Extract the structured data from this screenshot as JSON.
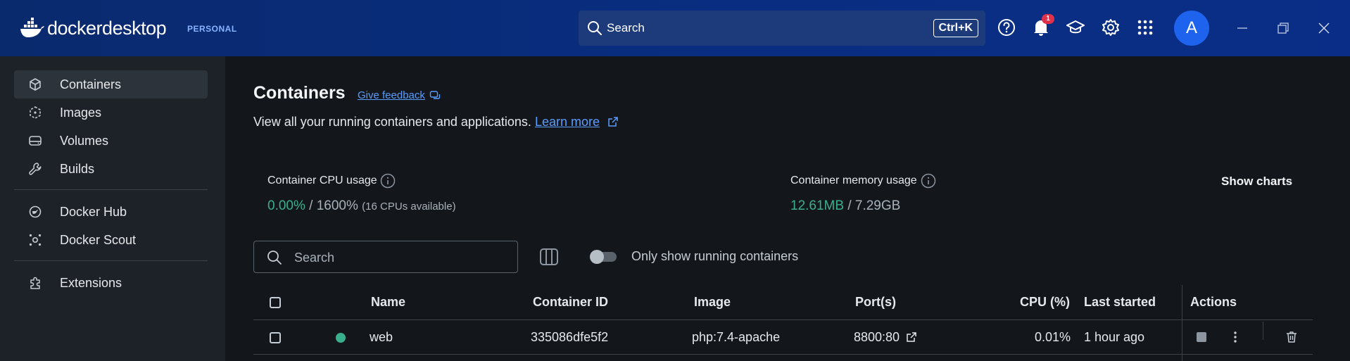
{
  "app": {
    "name_bold": "docker",
    "name_light": "desktop",
    "plan": "PERSONAL"
  },
  "topbar": {
    "search_placeholder": "Search",
    "shortcut": "Ctrl+K",
    "notifications_count": "1",
    "avatar_initial": "A",
    "icons": [
      "help-icon",
      "bell-icon",
      "learning-center-icon",
      "gear-icon",
      "apps-grid-icon",
      "minimize-icon",
      "restore-icon",
      "close-icon"
    ]
  },
  "sidebar": {
    "items": [
      {
        "label": "Containers",
        "icon": "containers-icon",
        "active": true
      },
      {
        "label": "Images",
        "icon": "images-icon"
      },
      {
        "label": "Volumes",
        "icon": "volumes-icon"
      },
      {
        "label": "Builds",
        "icon": "wrench-icon"
      },
      {
        "label": "Docker Hub",
        "icon": "docker-hub-icon"
      },
      {
        "label": "Docker Scout",
        "icon": "docker-scout-icon"
      },
      {
        "label": "Extensions",
        "icon": "extensions-icon"
      }
    ]
  },
  "main": {
    "title": "Containers",
    "feedback_label": "Give feedback",
    "subtitle": "View all your running containers and applications.",
    "learn_more": "Learn more",
    "cpu": {
      "label": "Container CPU usage",
      "used": "0.00%",
      "separator": " / ",
      "total": "1600%",
      "note": "(16 CPUs available)"
    },
    "memory": {
      "label": "Container memory usage",
      "used": "12.61MB",
      "separator": " / ",
      "total": "7.29GB"
    },
    "show_charts": "Show charts",
    "search_placeholder": "Search",
    "toggle_label": "Only show running containers",
    "table": {
      "headers": {
        "name": "Name",
        "container_id": "Container ID",
        "image": "Image",
        "ports": "Port(s)",
        "cpu": "CPU (%)",
        "last_started": "Last started",
        "actions": "Actions"
      },
      "rows": [
        {
          "status": "running",
          "name": "web",
          "container_id": "335086dfe5f2",
          "image": "php:7.4-apache",
          "ports": "8800:80",
          "cpu": "0.01%",
          "last_started": "1 hour ago"
        }
      ]
    }
  },
  "colors": {
    "titlebar": "#092d7f",
    "accent": "#1d63ed",
    "link": "#5a9cff",
    "running": "#3aaf8d",
    "badge": "#e0314b"
  }
}
